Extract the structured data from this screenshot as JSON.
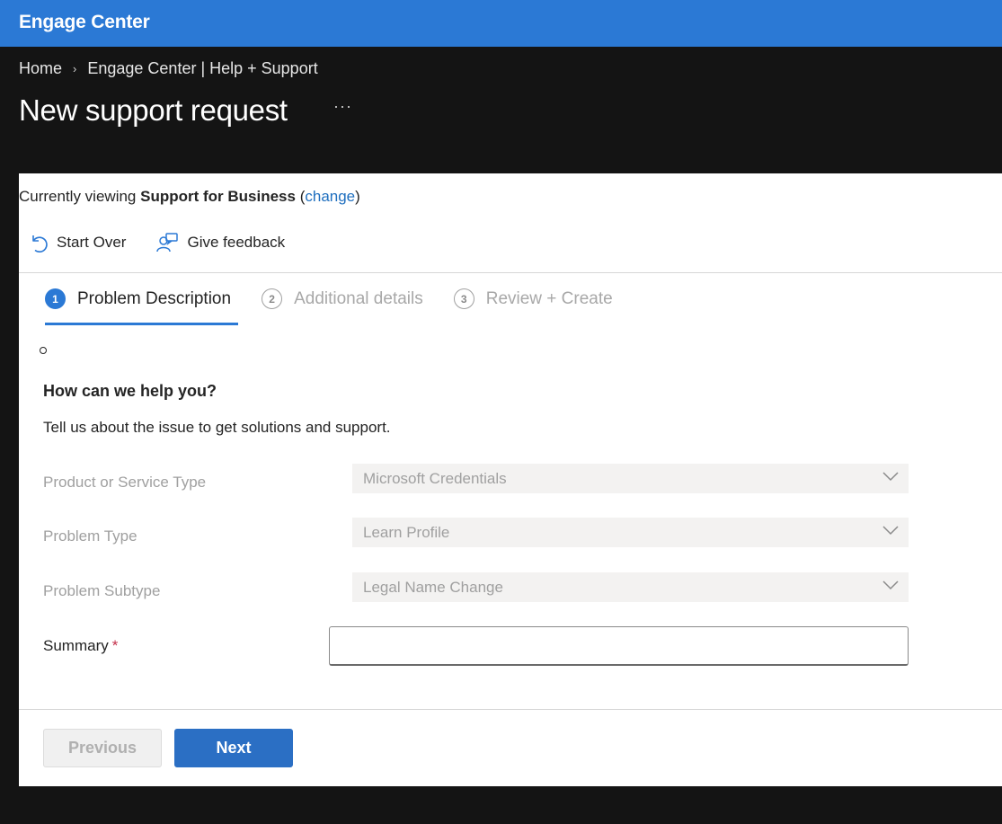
{
  "app": {
    "title": "Engage Center"
  },
  "breadcrumb": {
    "home": "Home",
    "current": "Engage Center | Help + Support"
  },
  "page": {
    "title": "New support request",
    "more": "···"
  },
  "viewing": {
    "prefix": "Currently viewing ",
    "context": "Support for Business",
    "open_paren": " (",
    "change_link": "change",
    "close_paren": ")"
  },
  "commands": {
    "start_over": "Start Over",
    "give_feedback": "Give feedback"
  },
  "steps": [
    {
      "number": "1",
      "label": "Problem Description",
      "active": true
    },
    {
      "number": "2",
      "label": "Additional details",
      "active": false
    },
    {
      "number": "3",
      "label": "Review + Create",
      "active": false
    }
  ],
  "form": {
    "title": "How can we help you?",
    "description": "Tell us about the issue to get solutions and support.",
    "product_label": "Product or Service Type",
    "product_value": "Microsoft Credentials",
    "problem_type_label": "Problem Type",
    "problem_type_value": "Learn Profile",
    "problem_subtype_label": "Problem Subtype",
    "problem_subtype_value": "Legal Name Change",
    "summary_label": "Summary",
    "summary_required_mark": "*",
    "summary_value": ""
  },
  "buttons": {
    "previous": "Previous",
    "next": "Next"
  },
  "colors": {
    "accent": "#2b79d5",
    "background": "#141414",
    "required": "#c4314b",
    "link": "#1f6fbf"
  },
  "icons": {
    "start_over": "refresh-icon",
    "give_feedback": "feedback-icon",
    "dropdown": "chevron-down-icon"
  }
}
